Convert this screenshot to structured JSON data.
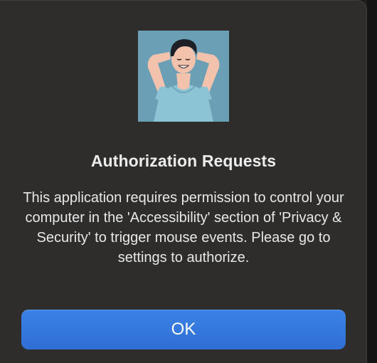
{
  "dialog": {
    "icon": "person-relaxing-illustration",
    "title": "Authorization Requests",
    "message": "This application requires permission to control your computer in the 'Accessibility' section of 'Privacy & Security' to trigger mouse events. Please go to settings to authorize.",
    "ok_label": "OK"
  },
  "colors": {
    "dialog_bg": "#2e2d2c",
    "accent": "#2f6fd4",
    "avatar_bg": "#6a9fb5"
  }
}
